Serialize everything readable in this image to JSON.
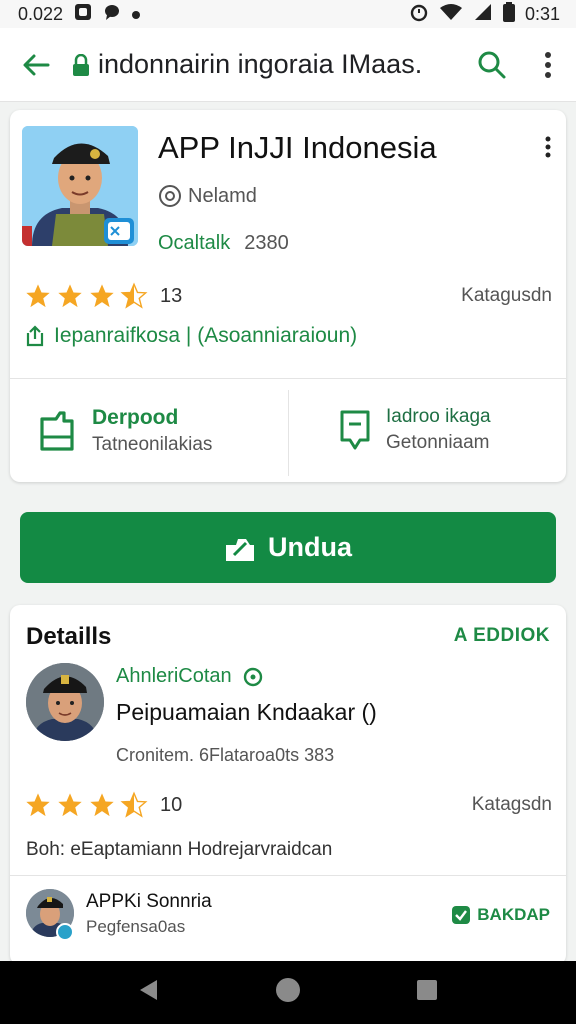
{
  "status_bar": {
    "time": "0.022",
    "battery": "0:31"
  },
  "toolbar": {
    "url": "indonnairin ingoraia IMaas."
  },
  "app": {
    "title": "APP InJJI Indonesia",
    "developer": "Nelamd",
    "version_label": "Ocaltalk",
    "version_number": "2380",
    "rating_stars": 3.5,
    "rating_count": "13",
    "category": "Katagusdn",
    "tags": "Iepanraifkosa | (Asoanniaraioun)"
  },
  "stats": {
    "left": {
      "title": "Derpood",
      "subtitle": "Tatneonilakias"
    },
    "right": {
      "title": "Iadroo ikaga",
      "subtitle": "Getonniaam"
    }
  },
  "install_button": {
    "label": "Undua"
  },
  "details": {
    "title": "Detaills",
    "link": "A EDDIOK",
    "dev_name": "AhnleriCotan",
    "description": "Peipuamaian Kndaakar ()",
    "meta": "Cronitem. 6Flataroa0ts 383",
    "rating_stars": 3.5,
    "rating_count": "10",
    "category": "Katagsdn",
    "note": "Boh: eEaptamiann Hodrejarvraidcan",
    "secondary": {
      "title": "APPKi Sonnria",
      "subtitle": "Pegfensa0as",
      "link": "BAKDAP"
    }
  },
  "colors": {
    "accent": "#138a44",
    "accent_text": "#1e8a45",
    "star": "#f5a623"
  }
}
